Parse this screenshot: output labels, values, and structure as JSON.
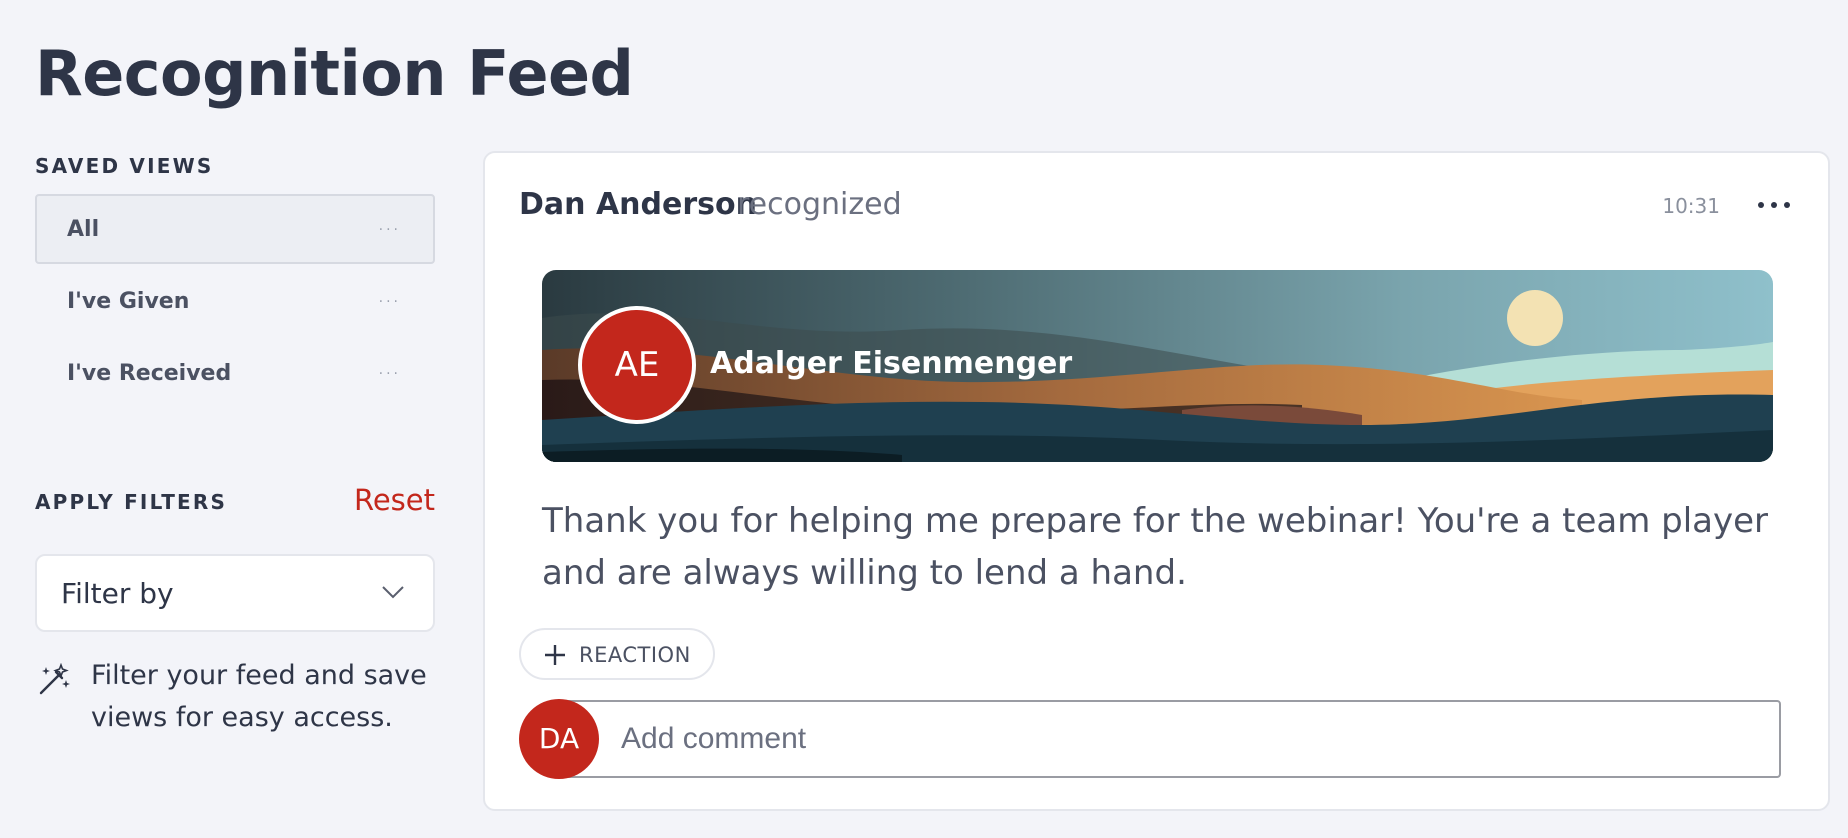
{
  "page": {
    "title": "Recognition Feed"
  },
  "sidebar": {
    "saved_views_label": "SAVED VIEWS",
    "views": [
      {
        "label": "All",
        "active": true,
        "more_icon": "ellipsis-icon"
      },
      {
        "label": "I've Given",
        "active": false,
        "more_icon": "ellipsis-icon"
      },
      {
        "label": "I've Received",
        "active": false,
        "more_icon": "ellipsis-icon"
      }
    ],
    "more_glyph": "···",
    "filters_label": "APPLY FILTERS",
    "reset_label": "Reset",
    "filter_select": {
      "label": "Filter by",
      "icon": "chevron-down-icon"
    },
    "hint": {
      "icon": "magic-wand-icon",
      "text": "Filter your feed and save views for easy access."
    }
  },
  "feed": {
    "post": {
      "giver": "Dan Anderson",
      "action": "recognized",
      "time": "10:31",
      "menu_icon": "more-horizontal-icon",
      "recipient": {
        "initials": "AE",
        "name": "Adalger Eisenmenger"
      },
      "message": "Thank you for helping me prepare for the webinar! You're a team player and are always willing to lend a hand.",
      "reaction_label": "REACTION",
      "reaction_icon": "plus-icon",
      "comment": {
        "avatar_initials": "DA",
        "placeholder": "Add comment"
      }
    }
  },
  "colors": {
    "accent_red": "#c3271c",
    "text_dark": "#2e3547",
    "background": "#f3f4f9"
  }
}
